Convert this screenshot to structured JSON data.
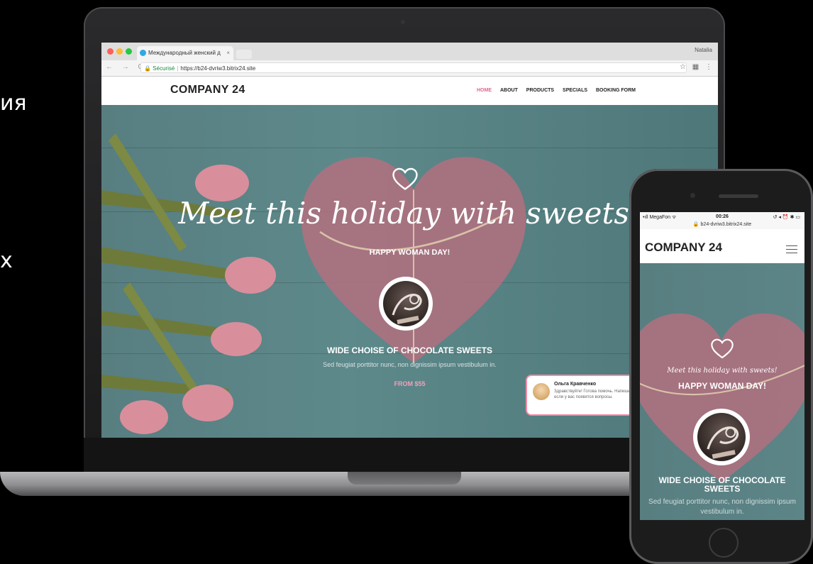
{
  "side_text": {
    "line1": "ия",
    "line2": "х"
  },
  "browser": {
    "tab_title": "Международный женский д",
    "tab_close": "×",
    "profile_name": "Natalia",
    "nav_buttons": "← → C",
    "secure_label": "🔒 Sécurisé",
    "url": "https://b24-dvriw3.bitrix24.site",
    "icons": [
      "star-icon",
      "extension-icon",
      "menu-icon"
    ]
  },
  "site": {
    "logo": "COMPANY 24",
    "nav": [
      "HOME",
      "ABOUT",
      "PRODUCTS",
      "SPECIALS",
      "BOOKING FORM"
    ],
    "active_nav": "HOME",
    "accent_color": "#e0668c",
    "hero": {
      "title": "Meet this holiday with sweets!",
      "subtitle": "HAPPY WOMAN DAY!",
      "section_title": "WIDE CHOISE OF CHOCOLATE SWEETS",
      "section_desc": "Sed feugiat porttitor nunc, non dignissim ipsum vestibulum in.",
      "price": "FROM $55"
    },
    "chat": {
      "name": "Ольга Кравченко",
      "message": "Здравствуйте! Готова помочь. Напишите мне, если у вас появятся вопросы."
    }
  },
  "phone": {
    "carrier": "•ıll MegaFon ᯤ",
    "time": "00:26",
    "status_right": "↺ ◂ ⏰ ✱ ▭",
    "url": "🔒 b24-dvriw3.bitrix24.site",
    "logo": "COMPANY 24",
    "hero": {
      "title": "Meet this holiday with sweets!",
      "subtitle": "HAPPY WOMAN DAY!",
      "section_title": "WIDE CHOISE OF CHOCOLATE SWEETS",
      "section_desc": "Sed feugiat porttitor nunc, non dignissim ipsum vestibulum in."
    }
  }
}
